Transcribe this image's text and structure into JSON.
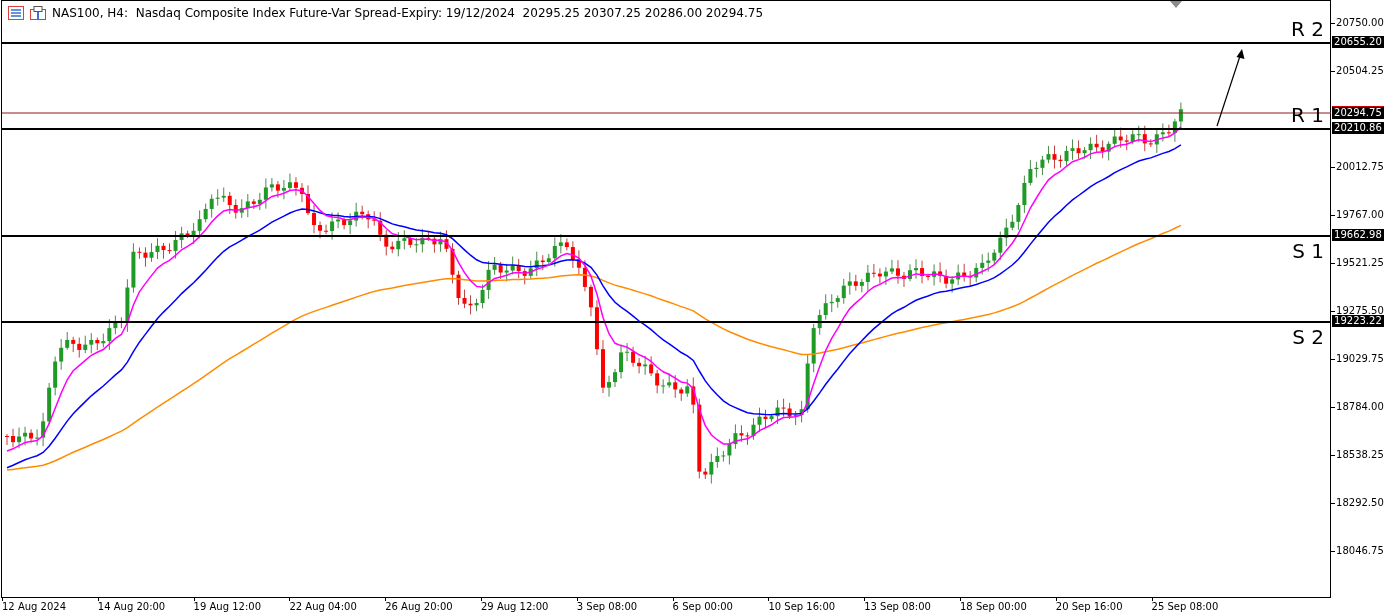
{
  "header": {
    "title": "NAS100, H4:  Nasdaq Composite Index Future-Var Spread-Expiry: 19/12/2024  20295.25 20307.25 20286.00 20294.75"
  },
  "levels": [
    {
      "label": "R 2",
      "price": "20655.20",
      "kind": "level"
    },
    {
      "label": "R 1",
      "price": "20210.86",
      "kind": "level"
    },
    {
      "label": "S 1",
      "price": "19662.98",
      "kind": "level"
    },
    {
      "label": "S 2",
      "price": "19223.22",
      "kind": "level"
    }
  ],
  "current_price": {
    "price": "20294.75"
  },
  "price_ticks": [
    "20750.00",
    "20504.25",
    "20012.75",
    "19767.00",
    "19521.25",
    "19275.50",
    "19029.75",
    "18784.00",
    "18538.25",
    "18292.50",
    "18046.75"
  ],
  "time_ticks": [
    "12 Aug 2024",
    "14 Aug 20:00",
    "19 Aug 12:00",
    "22 Aug 04:00",
    "26 Aug 20:00",
    "29 Aug 12:00",
    "3 Sep 08:00",
    "6 Sep 00:00",
    "10 Sep 16:00",
    "13 Sep 08:00",
    "18 Sep 00:00",
    "20 Sep 16:00",
    "25 Sep 08:00"
  ]
}
